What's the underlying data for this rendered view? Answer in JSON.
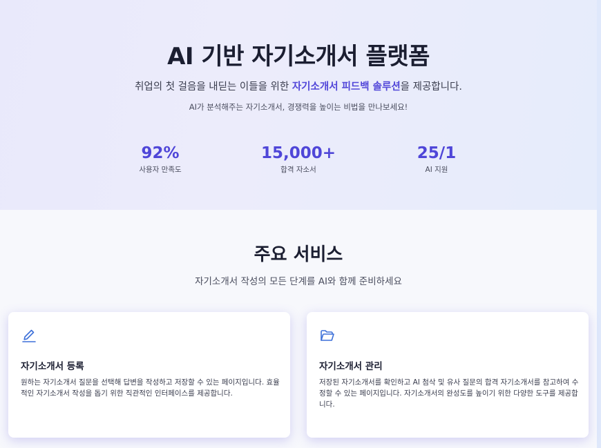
{
  "hero": {
    "title": "AI 기반 자기소개서 플랫폼",
    "subtitle_before": "취업의 첫 걸음을 내딛는 이들을 위한 ",
    "subtitle_highlight": "자기소개서 피드백 솔루션",
    "subtitle_after": "을 제공합니다.",
    "note": "AI가 분석해주는 자기소개서, 경쟁력을 높이는 비법을 만나보세요!",
    "stats": [
      {
        "value": "92%",
        "label": "사용자 만족도"
      },
      {
        "value": "15,000+",
        "label": "합격 자소서"
      },
      {
        "value": "25/1",
        "label": "AI 지원"
      }
    ]
  },
  "services": {
    "title": "주요 서비스",
    "subtitle": "자기소개서 작성의 모든 단계를 AI와 함께 준비하세요",
    "cards": [
      {
        "icon": "pencil-icon",
        "title": "자기소개서 등록",
        "description": "원하는 자기소개서 질문을 선택해 답변을 작성하고 저장할 수 있는 페이지입니다. 효율적인 자기소개서 작성을 돕기 위한 직관적인 인터페이스를 제공합니다."
      },
      {
        "icon": "folder-open-icon",
        "title": "자기소개서 관리",
        "description": "저장된 자기소개서를 확인하고 AI 첨삭 및 유사 질문의 합격 자기소개서를 참고하여 수정할 수 있는 페이지입니다. 자기소개서의 완성도를 높이기 위한 다양한 도구를 제공합니다."
      }
    ]
  },
  "colors": {
    "accent": "#4f46d8",
    "icon": "#3b6fd8"
  }
}
